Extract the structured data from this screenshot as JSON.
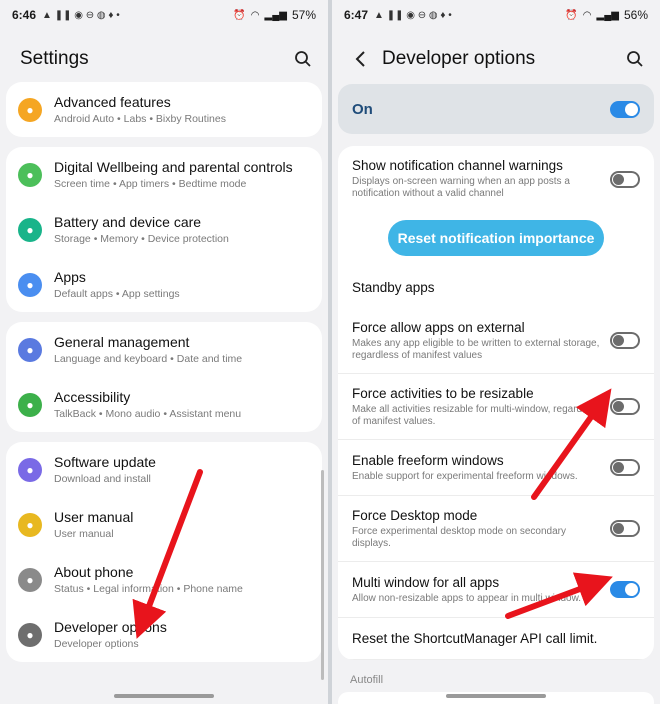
{
  "left": {
    "status": {
      "time": "6:46",
      "battery": "57%"
    },
    "title": "Settings",
    "cards": [
      [
        {
          "label": "Advanced features",
          "sub": "Android Auto • Labs • Bixby Routines",
          "color": "#f5a623",
          "icon": "star-icon"
        }
      ],
      [
        {
          "label": "Digital Wellbeing and parental controls",
          "sub": "Screen time • App timers • Bedtime mode",
          "color": "#4cbf5a",
          "icon": "wellbeing-icon"
        },
        {
          "label": "Battery and device care",
          "sub": "Storage • Memory • Device protection",
          "color": "#19b48a",
          "icon": "battery-care-icon"
        },
        {
          "label": "Apps",
          "sub": "Default apps • App settings",
          "color": "#4a8ef0",
          "icon": "apps-icon"
        }
      ],
      [
        {
          "label": "General management",
          "sub": "Language and keyboard • Date and time",
          "color": "#5a7ae0",
          "icon": "sliders-icon"
        },
        {
          "label": "Accessibility",
          "sub": "TalkBack • Mono audio • Assistant menu",
          "color": "#3cb04a",
          "icon": "accessibility-icon"
        }
      ],
      [
        {
          "label": "Software update",
          "sub": "Download and install",
          "color": "#7a6ae6",
          "icon": "update-icon"
        },
        {
          "label": "User manual",
          "sub": "User manual",
          "color": "#e8b820",
          "icon": "manual-icon"
        },
        {
          "label": "About phone",
          "sub": "Status • Legal information • Phone name",
          "color": "#8a8a8a",
          "icon": "info-icon"
        },
        {
          "label": "Developer options",
          "sub": "Developer options",
          "color": "#6e6e6e",
          "icon": "braces-icon"
        }
      ]
    ]
  },
  "right": {
    "status": {
      "time": "6:47",
      "battery": "56%"
    },
    "title": "Developer options",
    "master": {
      "label": "On",
      "on": true
    },
    "items": [
      {
        "label": "Show notification channel warnings",
        "sub": "Displays on-screen warning when an app posts a notification without a valid channel",
        "toggle": "off"
      },
      {
        "button": "Reset notification importance"
      },
      {
        "label": "Standby apps",
        "sub": "",
        "toggle": "none"
      },
      {
        "label": "Force allow apps on external",
        "sub": "Makes any app eligible to be written to external storage, regardless of manifest values",
        "toggle": "off"
      },
      {
        "label": "Force activities to be resizable",
        "sub": "Make all activities resizable for multi-window, regardless of manifest values.",
        "toggle": "off"
      },
      {
        "label": "Enable freeform windows",
        "sub": "Enable support for experimental freeform windows.",
        "toggle": "off"
      },
      {
        "label": "Force Desktop mode",
        "sub": "Force experimental desktop mode on secondary displays.",
        "toggle": "off"
      },
      {
        "label": "Multi window for all apps",
        "sub": "Allow non-resizable apps to appear in multi window.",
        "toggle": "on"
      },
      {
        "label": "Reset the ShortcutManager API call limit.",
        "sub": "",
        "toggle": "none"
      }
    ],
    "section": "Autofill"
  }
}
